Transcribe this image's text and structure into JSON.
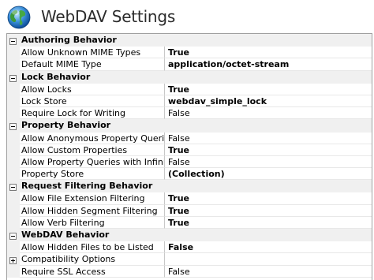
{
  "window": {
    "title": "WebDAV Settings"
  },
  "icons": {
    "header_icon": "globe-icon",
    "expanded": "minus-toggle-icon",
    "collapsed": "plus-toggle-icon"
  },
  "categories": [
    {
      "label": "Authoring Behavior",
      "expanded": true,
      "properties": [
        {
          "name": "Allow Unknown MIME Types",
          "value": "True",
          "bold": true
        },
        {
          "name": "Default MIME Type",
          "value": "application/octet-stream",
          "bold": true
        }
      ]
    },
    {
      "label": "Lock Behavior",
      "expanded": true,
      "properties": [
        {
          "name": "Allow Locks",
          "value": "True",
          "bold": true
        },
        {
          "name": "Lock Store",
          "value": "webdav_simple_lock",
          "bold": true
        },
        {
          "name": "Require Lock for Writing",
          "value": "False",
          "bold": false
        }
      ]
    },
    {
      "label": "Property Behavior",
      "expanded": true,
      "properties": [
        {
          "name": "Allow Anonymous Property Queries",
          "value": "False",
          "bold": false
        },
        {
          "name": "Allow Custom Properties",
          "value": "True",
          "bold": true
        },
        {
          "name": "Allow Property Queries with Infinite Depth",
          "value": "False",
          "bold": false
        },
        {
          "name": "Property Store",
          "value": "(Collection)",
          "bold": true
        }
      ]
    },
    {
      "label": "Request Filtering Behavior",
      "expanded": true,
      "properties": [
        {
          "name": "Allow File Extension Filtering",
          "value": "True",
          "bold": true
        },
        {
          "name": "Allow Hidden Segment Filtering",
          "value": "True",
          "bold": true
        },
        {
          "name": "Allow Verb Filtering",
          "value": "True",
          "bold": true
        }
      ]
    },
    {
      "label": "WebDAV Behavior",
      "expanded": true,
      "properties": [
        {
          "name": "Allow Hidden Files to be Listed",
          "value": "False",
          "bold": true
        },
        {
          "name": "Compatibility Options",
          "value": "",
          "bold": false,
          "collapsible": true
        },
        {
          "name": "Require SSL Access",
          "value": "False",
          "bold": false
        }
      ]
    }
  ]
}
